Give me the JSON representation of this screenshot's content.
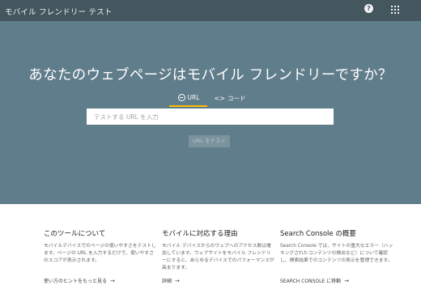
{
  "header": {
    "title": "モバイル フレンドリー テスト",
    "help_icon": "help-icon",
    "apps_icon": "apps-grid-icon"
  },
  "hero": {
    "headline": "あなたのウェブページはモバイル フレンドリーですか？",
    "tabs": [
      {
        "label": "URL",
        "icon": "globe-icon",
        "active": true
      },
      {
        "label": "コード",
        "icon": "code-icon",
        "active": false
      }
    ],
    "url_placeholder": "テストする URL を入力",
    "url_value": "",
    "test_button": "URL をテスト"
  },
  "colors": {
    "topbar": "#44575f",
    "hero": "#607d8b",
    "tab_indicator": "#fbbc04",
    "button_disabled": "#7b939e"
  },
  "info": [
    {
      "title": "このツールについて",
      "text": "モバイルデバイスでのページの使いやすさをテストします。ページの URL を入力するだけで、使いやすさのスコアが表示されます。",
      "link": "使い方のヒントをもっと見る"
    },
    {
      "title": "モバイルに対応する理由",
      "text": "モバイル デバイスからのウェブへのアクセス数は増加しています。ウェブサイトをモバイル フレンドリーにすると、あらゆるデバイスでのパフォーマンスが高まります。",
      "link": "詳細"
    },
    {
      "title": "Search Console の概要",
      "text": "Search Console では、サイトの重大なエラー（ハッキングされたコンテンツの検出など）について確認し、検索結果でのコンテンツの表示を管理できます。",
      "link": "SEARCH CONSOLE に移動"
    }
  ]
}
